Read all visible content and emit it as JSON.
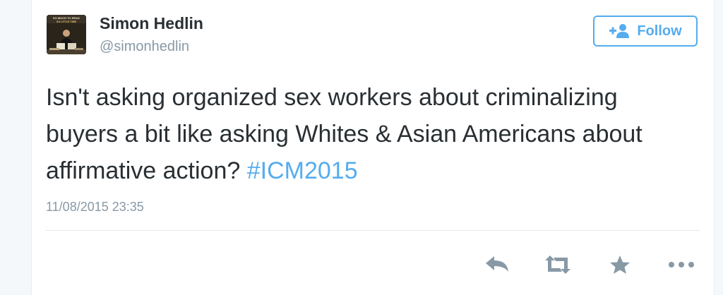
{
  "tweet": {
    "author_name": "Simon Hedlin",
    "author_handle": "@simonhedlin",
    "avatar_caption_top": "SO MUCH TO READ",
    "avatar_caption_bottom": "SO LITTLE TIME",
    "text_before_hashtag": "Isn't asking organized sex workers about criminalizing buyers a bit like asking Whites & Asian Americans about affirmative action? ",
    "hashtag": "#ICM2015",
    "timestamp": "11/08/2015 23:35"
  },
  "follow_button": {
    "label": "Follow",
    "icon": "add-user-icon"
  },
  "actions": [
    {
      "name": "reply",
      "icon": "reply-icon"
    },
    {
      "name": "retweet",
      "icon": "retweet-icon"
    },
    {
      "name": "favorite",
      "icon": "star-icon"
    },
    {
      "name": "more",
      "icon": "more-icon"
    }
  ],
  "colors": {
    "accent": "#55acee",
    "text": "#292f33",
    "muted": "#8899a6",
    "action_icon": "#8899a6",
    "divider": "#e1e8ed"
  }
}
